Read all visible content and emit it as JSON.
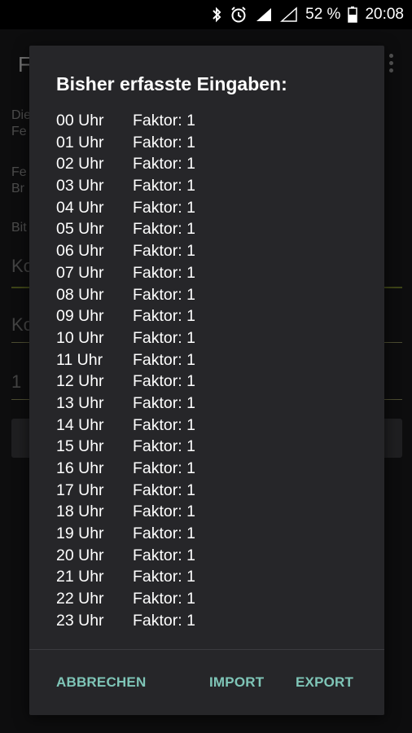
{
  "status_bar": {
    "battery": "52 %",
    "time": "20:08",
    "icons": [
      "bluetooth-icon",
      "alarm-icon",
      "signal-icon",
      "signal-empty-icon",
      "battery-icon"
    ]
  },
  "background_app": {
    "title": "F",
    "text_1": "Die\nFe",
    "text_2": "Fe\nBr",
    "text_3": "Bit",
    "field_1": "Ko",
    "field_2": "Ko",
    "field_3": "1"
  },
  "dialog": {
    "title": "Bisher erfasste Eingaben:",
    "rows": [
      {
        "hour": "00 Uhr",
        "factor": "Faktor: 1"
      },
      {
        "hour": "01 Uhr",
        "factor": "Faktor: 1"
      },
      {
        "hour": "02 Uhr",
        "factor": "Faktor: 1"
      },
      {
        "hour": "03 Uhr",
        "factor": "Faktor: 1"
      },
      {
        "hour": "04 Uhr",
        "factor": "Faktor: 1"
      },
      {
        "hour": "05 Uhr",
        "factor": "Faktor: 1"
      },
      {
        "hour": "06 Uhr",
        "factor": "Faktor: 1"
      },
      {
        "hour": "07 Uhr",
        "factor": "Faktor: 1"
      },
      {
        "hour": "08 Uhr",
        "factor": "Faktor: 1"
      },
      {
        "hour": "09 Uhr",
        "factor": "Faktor: 1"
      },
      {
        "hour": "10 Uhr",
        "factor": "Faktor: 1"
      },
      {
        "hour": "11 Uhr",
        "factor": "Faktor: 1"
      },
      {
        "hour": "12 Uhr",
        "factor": "Faktor: 1"
      },
      {
        "hour": "13 Uhr",
        "factor": "Faktor: 1"
      },
      {
        "hour": "14 Uhr",
        "factor": "Faktor: 1"
      },
      {
        "hour": "15 Uhr",
        "factor": "Faktor: 1"
      },
      {
        "hour": "16 Uhr",
        "factor": "Faktor: 1"
      },
      {
        "hour": "17 Uhr",
        "factor": "Faktor: 1"
      },
      {
        "hour": "18 Uhr",
        "factor": "Faktor: 1"
      },
      {
        "hour": "19 Uhr",
        "factor": "Faktor: 1"
      },
      {
        "hour": "20 Uhr",
        "factor": "Faktor: 1"
      },
      {
        "hour": "21 Uhr",
        "factor": "Faktor: 1"
      },
      {
        "hour": "22 Uhr",
        "factor": "Faktor: 1"
      },
      {
        "hour": "23 Uhr",
        "factor": "Faktor: 1"
      }
    ],
    "actions": {
      "cancel": "ABBRECHEN",
      "import": "IMPORT",
      "export": "EXPORT"
    }
  },
  "colors": {
    "accent": "#7fc5b7",
    "dialog_bg": "#262629",
    "field_underline": "#6f7d2a"
  }
}
